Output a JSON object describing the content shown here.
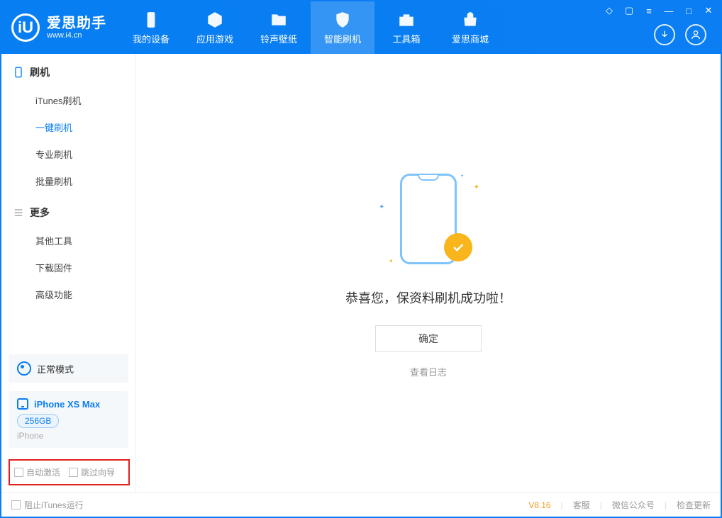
{
  "app": {
    "title": "爱思助手",
    "subtitle": "www.i4.cn"
  },
  "tabs": {
    "device": "我的设备",
    "apps": "应用游戏",
    "ring": "铃声壁纸",
    "flash": "智能刷机",
    "toolbox": "工具箱",
    "store": "爱思商城"
  },
  "sidebar": {
    "section_flash": "刷机",
    "flash_items": {
      "itunes": "iTunes刷机",
      "oneclick": "一键刷机",
      "pro": "专业刷机",
      "batch": "批量刷机"
    },
    "section_more": "更多",
    "more_items": {
      "other": "其他工具",
      "firmware": "下载固件",
      "advanced": "高级功能"
    },
    "mode_label": "正常模式",
    "device": {
      "name": "iPhone XS Max",
      "storage": "256GB",
      "type": "iPhone"
    },
    "options": {
      "auto_activate": "自动激活",
      "skip_guide": "跳过向导"
    }
  },
  "main": {
    "success_text": "恭喜您，保资料刷机成功啦！",
    "ok_button": "确定",
    "view_log": "查看日志"
  },
  "footer": {
    "block_itunes": "阻止iTunes运行",
    "version": "V8.16",
    "support": "客服",
    "wechat": "微信公众号",
    "update": "检查更新"
  }
}
